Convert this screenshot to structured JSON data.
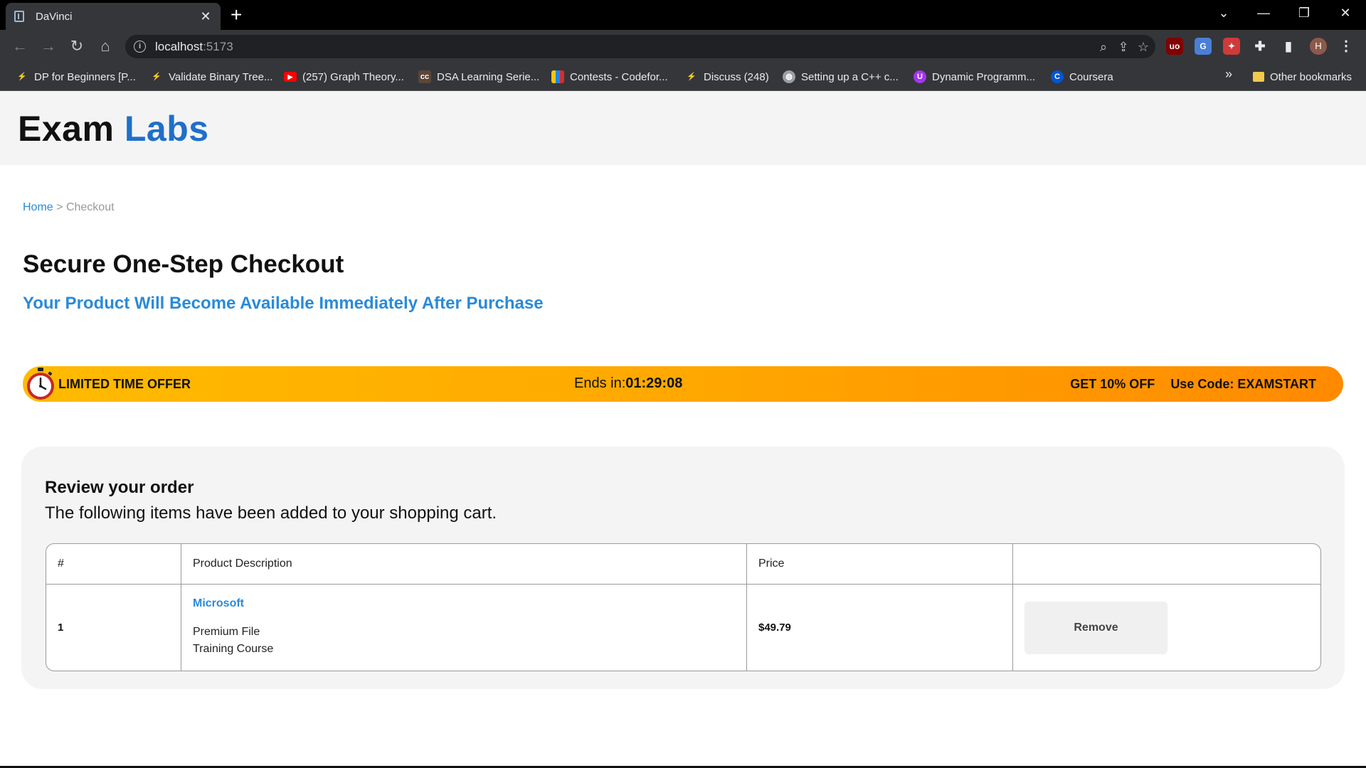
{
  "browser": {
    "tab_title": "DaVinci",
    "url_host": "localhost",
    "url_port": ":5173",
    "profile_initial": "H",
    "bookmarks": [
      {
        "label": "DP for Beginners [P...",
        "icon": "leetcode-icon"
      },
      {
        "label": "Validate Binary Tree...",
        "icon": "leetcode-icon"
      },
      {
        "label": "(257) Graph Theory...",
        "icon": "youtube-icon"
      },
      {
        "label": "DSA Learning Serie...",
        "icon": "codechef-icon"
      },
      {
        "label": "Contests - Codefor...",
        "icon": "codeforces-icon"
      },
      {
        "label": "Discuss (248)",
        "icon": "leetcode-icon"
      },
      {
        "label": "Setting up a C++ c...",
        "icon": "globe-icon"
      },
      {
        "label": "Dynamic Programm...",
        "icon": "udemy-icon"
      },
      {
        "label": "Coursera",
        "icon": "coursera-icon"
      }
    ],
    "bookmarks_overflow": "»",
    "other_bookmarks": "Other bookmarks"
  },
  "site": {
    "logo_part1": "Exam",
    "logo_part2": "Labs",
    "brand_color": "#1f6fc9"
  },
  "breadcrumb": {
    "home": "Home",
    "separator": ">",
    "current": "Checkout"
  },
  "checkout": {
    "title": "Secure One-Step Checkout",
    "subtitle": "Your Product Will Become Available Immediately After Purchase"
  },
  "offer": {
    "label": "LIMITED TIME OFFER",
    "ends_label": "Ends in:",
    "countdown": "01:29:08",
    "discount": "GET 10% OFF",
    "code_text": "Use Code: EXAMSTART"
  },
  "review": {
    "title": "Review your order",
    "description": "The following items have been added to your shopping cart.",
    "columns": [
      "#",
      "Product Description",
      "Price",
      ""
    ],
    "items": [
      {
        "index": "1",
        "vendor": "Microsoft",
        "line1": "Premium File",
        "line2": "Training Course",
        "price": "$49.79",
        "remove_label": "Remove"
      }
    ]
  }
}
